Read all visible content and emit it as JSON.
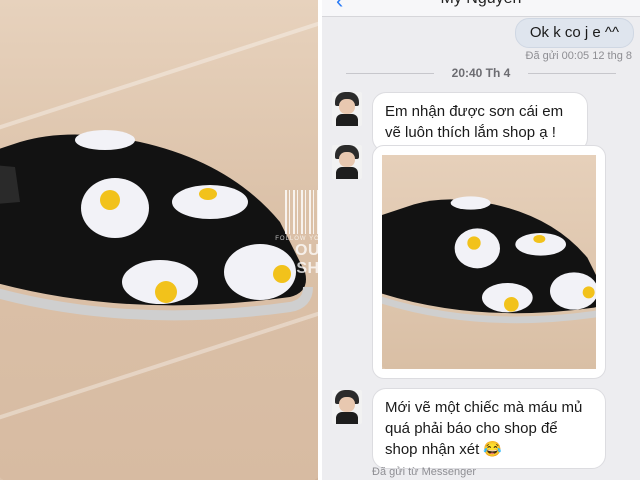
{
  "watermark": {
    "line1": "FOLLOW YOUR DREAMS",
    "brand": "OUBO SHOP"
  },
  "chat": {
    "contact_name": "My Nguyen",
    "back_icon": "chevron-left-icon",
    "outgoing": [
      {
        "text": "Ok k co j e ^^",
        "status": "Đã gửi 00:05 12 thg 8"
      }
    ],
    "separator": "20:40 Th 4",
    "incoming": [
      {
        "text": "Em nhận được sơn cái em vẽ luôn thích lắm shop ạ !"
      },
      {
        "text": "Mới vẽ một chiếc mà máu mủ quá phải báo cho shop để shop nhận xét 😂"
      }
    ],
    "footer": "Đã gửi từ Messenger"
  },
  "colors": {
    "accent": "#2c7cf6",
    "bubble_in": "#ffffff",
    "bubble_out": "#dfe5ee",
    "shoe": "#111111",
    "egg_yolk": "#f2c21b"
  }
}
